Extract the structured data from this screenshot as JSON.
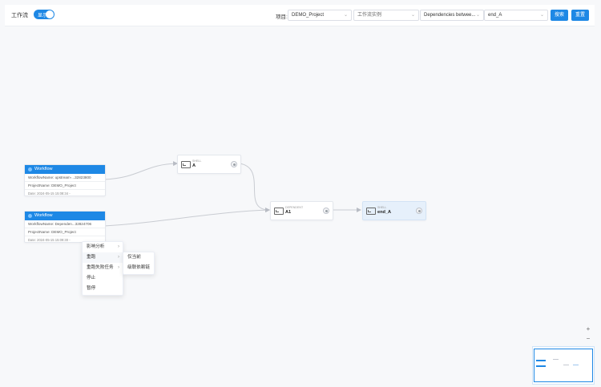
{
  "toolbar": {
    "workflow_label": "工作流",
    "toggle_text": "显示",
    "project_label": "项目:",
    "project_value": "DEMO_Project",
    "instance_placeholder": "工作流实例",
    "dependency_value": "Dependencies betwee...",
    "task_value": "end_A",
    "search_button": "搜索",
    "reset_button": "重置"
  },
  "workflows": [
    {
      "header": "Workflow",
      "name_line": "WorkflowName: upstream-...32823800",
      "project_line": "ProjectName: DEMO_Project",
      "date_line": "Date: 2024-05-15 15:08:34 -"
    },
    {
      "header": "Workflow",
      "name_line": "WorkflowName: Dependen...32824706",
      "project_line": "ProjectName: DEMO_Project",
      "date_line": "Date: 2024-05-15 15:09:30 -"
    }
  ],
  "tasks": [
    {
      "type": "SHELL",
      "name": "A"
    },
    {
      "type": "DEPENDENT",
      "name": "A1"
    },
    {
      "type": "SHELL",
      "name": "end_A"
    }
  ],
  "context_menu": {
    "items": [
      {
        "label": "影响分析",
        "has_submenu": true
      },
      {
        "label": "重跑",
        "has_submenu": true
      },
      {
        "label": "重跑失败任务",
        "has_submenu": true
      },
      {
        "label": "停止",
        "has_submenu": false
      },
      {
        "label": "暂停",
        "has_submenu": false
      }
    ],
    "submenu": [
      "仅当前",
      "级联依赖链"
    ]
  },
  "zoom": {
    "in": "+",
    "out": "−"
  },
  "colors": {
    "primary": "#1e88e5",
    "edge": "#c9ccd2",
    "canvas": "#f7f8fa",
    "selected_node": "#e6f0fb"
  }
}
